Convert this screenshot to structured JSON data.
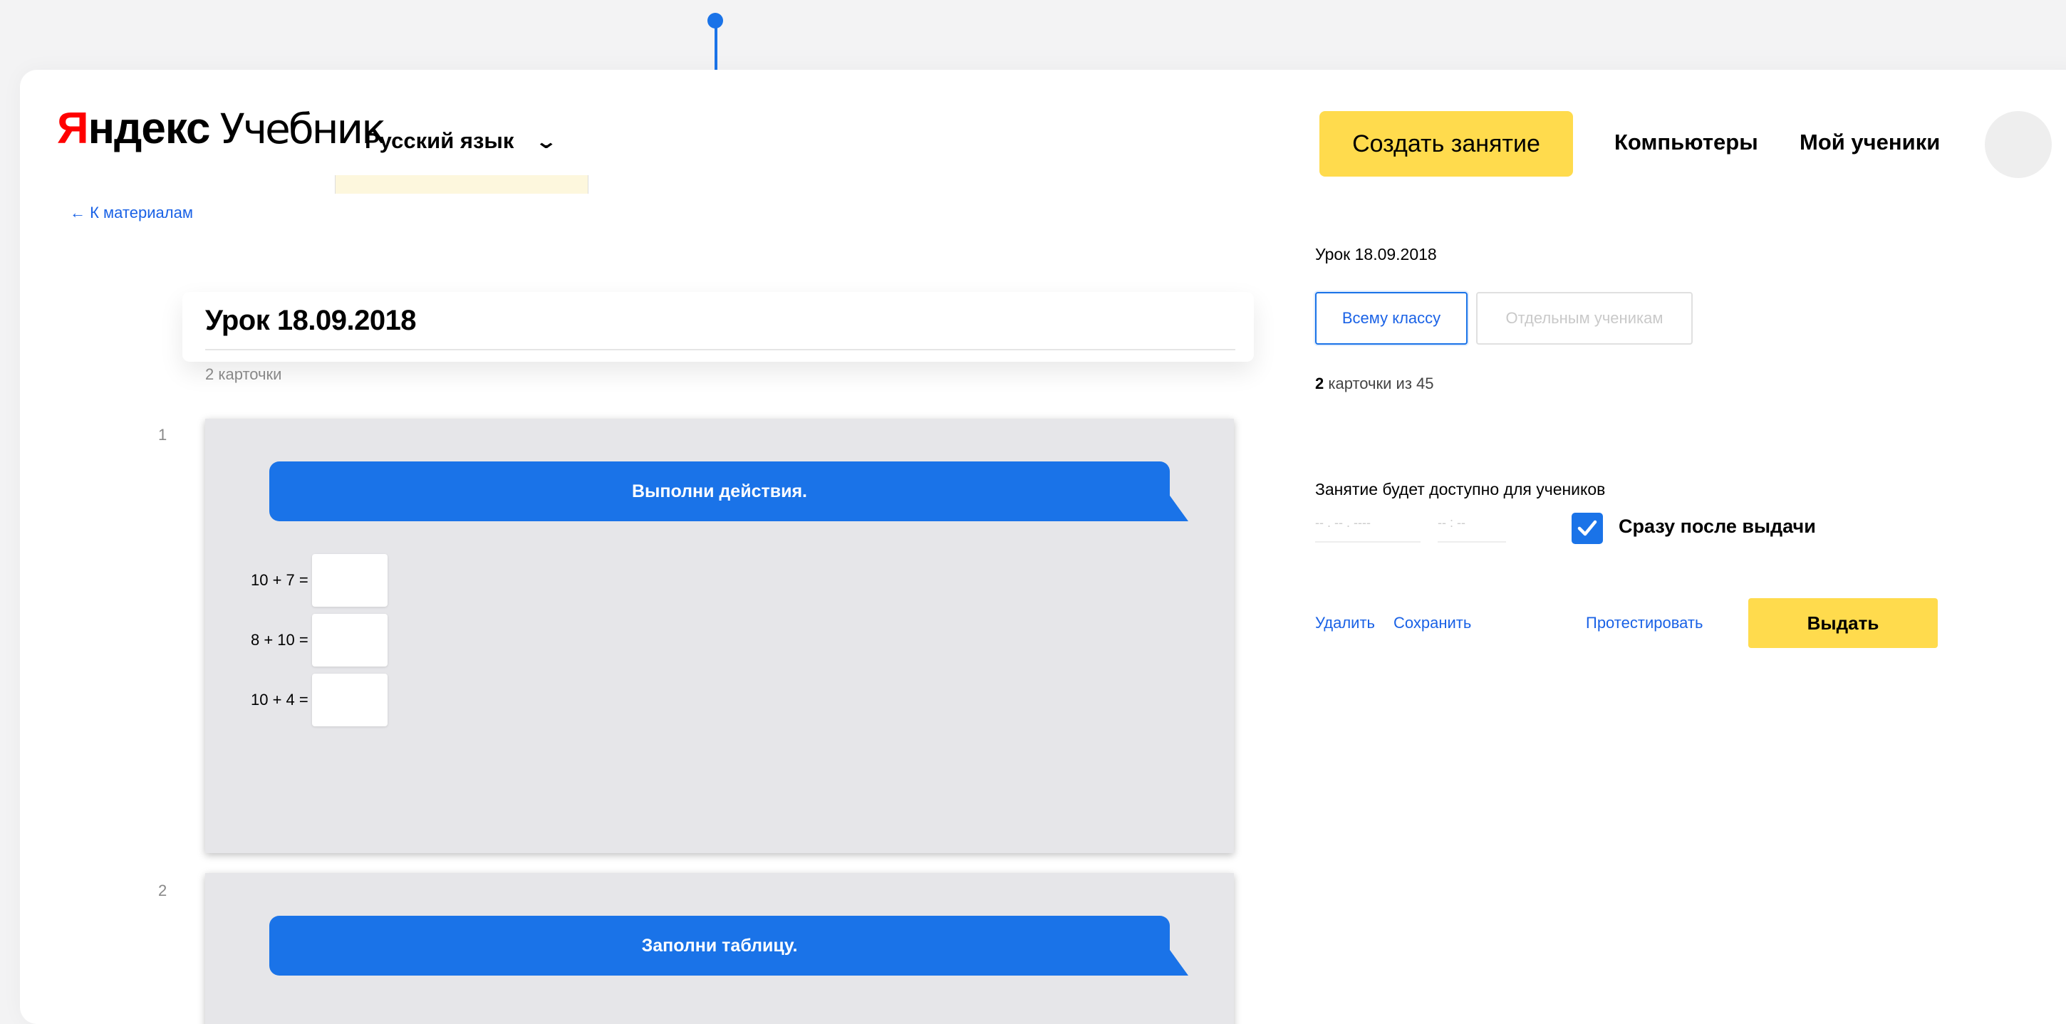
{
  "header": {
    "logo_brand_first": "Я",
    "logo_brand_rest": "ндекс",
    "logo_product": "Учебник",
    "subject": "Русский язык",
    "create_button": "Создать занятие",
    "nav_computers": "Компьютеры",
    "nav_students": "Мой ученики"
  },
  "back_link": "← К материалам",
  "lesson": {
    "title": "Урок 18.09.2018",
    "cards_count": "2 карточки"
  },
  "cards": [
    {
      "number": "1",
      "instruction": "Выполни действия.",
      "equations": [
        "10 + 7 =",
        "8 + 10 =",
        "10 + 4 ="
      ]
    },
    {
      "number": "2",
      "instruction": "Заполни таблицу."
    }
  ],
  "sidebar": {
    "title": "Урок 18.09.2018",
    "tab_all": "Всему классу",
    "tab_individual": "Отдельным ученикам",
    "count_bold": "2",
    "count_rest": " карточки из 45",
    "availability_label": "Занятие будет доступно для учеников",
    "date_placeholder": "-- . -- . ----",
    "time_placeholder": "-- : --",
    "checkbox_label": "Сразу после выдачи",
    "checkbox_checked": true,
    "delete_link": "Удалить",
    "save_link": "Сохранить",
    "test_link": "Протестировать",
    "issue_button": "Выдать"
  },
  "colors": {
    "accent_blue": "#1a73e8",
    "yellow": "#ffdb4d",
    "logo_red": "#ff0000"
  }
}
